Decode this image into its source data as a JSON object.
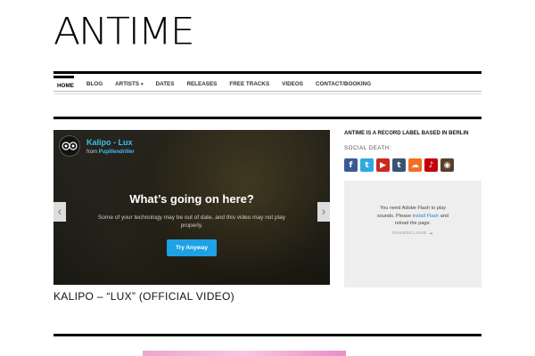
{
  "site": {
    "logo": "ANTIME"
  },
  "nav": {
    "items": [
      {
        "label": "HOME",
        "active": true
      },
      {
        "label": "BLOG"
      },
      {
        "label": "ARTISTS",
        "caret": "▾"
      },
      {
        "label": "DATES"
      },
      {
        "label": "RELEASES"
      },
      {
        "label": "FREE TRACKS"
      },
      {
        "label": "VIDEOS"
      },
      {
        "label": "CONTACT/BOOKING"
      }
    ]
  },
  "video": {
    "title": "Kalipo - Lux",
    "from_label": "from",
    "from_user": "Pupillendriller",
    "message_heading": "What’s going on here?",
    "message_body": "Some of your technology may be out of date, and this video may not play properly.",
    "button": "Try Anyway",
    "prev_arrow": "‹",
    "next_arrow": "›"
  },
  "post": {
    "caption": "KALIPO – “LUX” (OFFICIAL VIDEO)"
  },
  "sidebar": {
    "title": "ANTIME IS A RECORD LABEL BASED IN BERLIN",
    "social_heading": "SOCIAL DEATH:",
    "social_icons": [
      {
        "name": "facebook-icon",
        "glyph": "f",
        "color": "#3b5998"
      },
      {
        "name": "twitter-icon",
        "glyph": "t",
        "color": "#2fa9e0"
      },
      {
        "name": "youtube-icon",
        "glyph": "▶",
        "color": "#cc2a20"
      },
      {
        "name": "tumblr-icon",
        "glyph": "t",
        "color": "#3a5470"
      },
      {
        "name": "soundcloud-icon",
        "glyph": "☁",
        "color": "#f26f23"
      },
      {
        "name": "lastfm-icon",
        "glyph": "♪",
        "color": "#c3000d"
      },
      {
        "name": "instagram-icon",
        "glyph": "◉",
        "color": "#5b3e2a"
      }
    ],
    "flash_line1": "You need Adobe Flash to play",
    "flash_line2_pre": "sounds. Please ",
    "flash_link": "install Flash",
    "flash_line2_post": " and",
    "flash_line3": "reload the page.",
    "soundcloud_label": "SOUNDCLOUD"
  }
}
